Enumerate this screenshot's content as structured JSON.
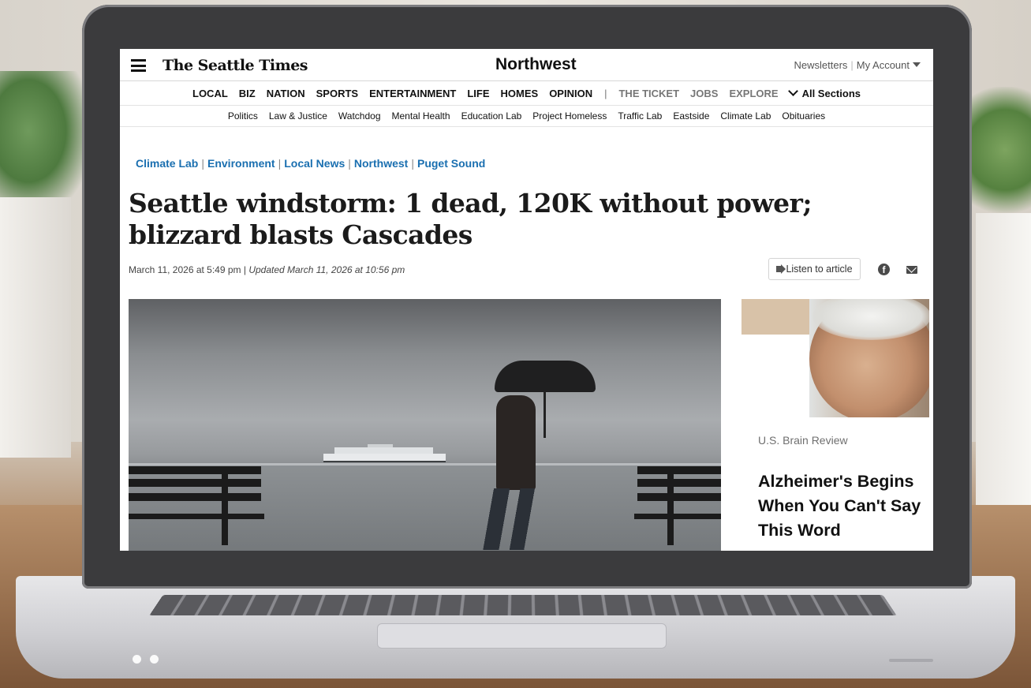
{
  "site": {
    "logo": "The Seattle Times",
    "section": "Northwest",
    "account_links": [
      "Newsletters",
      "My Account"
    ]
  },
  "main_nav": {
    "items": [
      "LOCAL",
      "BIZ",
      "NATION",
      "SPORTS",
      "ENTERTAINMENT",
      "LIFE",
      "HOMES",
      "OPINION"
    ],
    "divider": "|",
    "secondary": [
      "THE TICKET",
      "JOBS",
      "EXPLORE"
    ],
    "all_sections": "All Sections"
  },
  "sub_nav": {
    "items": [
      "Politics",
      "Law & Justice",
      "Watchdog",
      "Mental Health",
      "Education Lab",
      "Project Homeless",
      "Traffic Lab",
      "Eastside",
      "Climate Lab",
      "Obituaries"
    ]
  },
  "article": {
    "breadcrumbs": [
      "Climate Lab",
      "Environment",
      "Local News",
      "Northwest",
      "Puget Sound"
    ],
    "headline": "Seattle windstorm: 1 dead, 120K without power; blizzard blasts Cascades",
    "published": "March 11, 2026 at 5:49 pm",
    "separator": "|",
    "updated": "Updated March 11, 2026 at 10:56 pm",
    "listen_label": "Listen to article"
  },
  "ad": {
    "sponsor": "U.S. Brain Review",
    "title": "Alzheimer's Begins When You Can't Say This Word"
  },
  "icons": {
    "menu": "hamburger-icon",
    "caret": "caret-down-icon",
    "all_sections": "chevron-down-icon",
    "listen": "speaker-icon",
    "facebook": "facebook-icon",
    "email": "email-icon"
  },
  "colors": {
    "link_blue": "#1a6fb0",
    "headline": "#1b1b1b",
    "nav_grey": "#767676"
  }
}
